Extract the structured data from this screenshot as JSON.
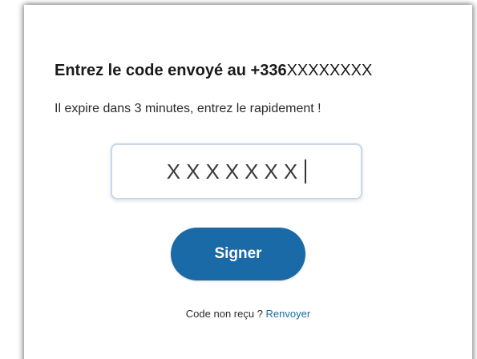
{
  "header": {
    "title_prefix": "Entrez le code envoyé au +336",
    "title_phone_masked": "XXXXXXXX",
    "subtitle": "Il expire dans 3 minutes, entrez le rapidement !"
  },
  "code_input": {
    "value": "XXXXXXX"
  },
  "actions": {
    "sign_label": "Signer",
    "resend_prompt": "Code non reçu ?",
    "resend_link": "Renvoyer"
  },
  "colors": {
    "accent": "#1a6aa8",
    "input_border": "#c9d7e8"
  }
}
